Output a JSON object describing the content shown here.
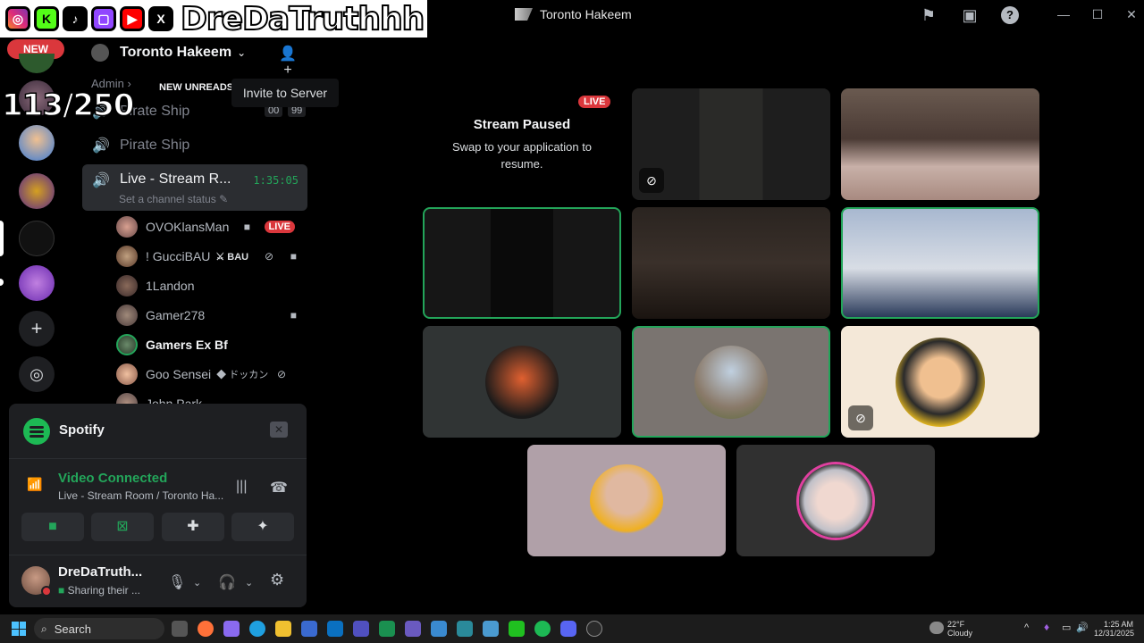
{
  "window": {
    "title": "Toronto Hakeem",
    "icons": [
      "inbox-flag-icon",
      "screen-share-icon",
      "help-icon"
    ],
    "controls": [
      "minimize",
      "maximize",
      "close"
    ]
  },
  "overlay": {
    "handle": "DreDaTruthhh",
    "socials": [
      "instagram",
      "kick",
      "tiktok",
      "twitch",
      "youtube",
      "x"
    ],
    "counter": "113/250"
  },
  "rail": {
    "new_label": "NEW",
    "add_server": "+",
    "discover": "compass"
  },
  "server": {
    "name": "Toronto Hakeem",
    "category": "Admin",
    "new_unreads": "NEW UNREADS",
    "invite_tooltip": "Invite to Server",
    "channels": [
      {
        "name": "Pirate Ship",
        "badges": [
          "00",
          "99"
        ]
      },
      {
        "name": "Pirate Ship"
      }
    ],
    "active_channel": {
      "name": "Live - Stream R...",
      "timer": "1:35:05",
      "status_placeholder": "Set a channel status"
    },
    "voice_users": [
      {
        "name": "OVOKlansMan",
        "live": "LIVE"
      },
      {
        "name": "! GucciBAU",
        "tag": "BAU"
      },
      {
        "name": "1Landon"
      },
      {
        "name": "Gamer278"
      },
      {
        "name": "Gamers Ex Bf"
      },
      {
        "name": "Goo Sensei",
        "tag": "ドッカン"
      },
      {
        "name": "John Park"
      }
    ]
  },
  "spotify": {
    "name": "Spotify"
  },
  "voice": {
    "status": "Video Connected",
    "location": "Live - Stream Room / Toronto Ha..."
  },
  "user": {
    "name": "DreDaTruth...",
    "status": "Sharing their ..."
  },
  "stream": {
    "live": "LIVE",
    "paused_title": "Stream Paused",
    "paused_sub": "Swap to your application to resume."
  },
  "taskbar": {
    "search": "Search",
    "weather_temp": "22°F",
    "weather_cond": "Cloudy",
    "time": "1:25 AM",
    "date": "12/31/2025"
  },
  "colors": {
    "accent_green": "#23a55a",
    "live_red": "#da373c",
    "spotify_green": "#1db954"
  }
}
